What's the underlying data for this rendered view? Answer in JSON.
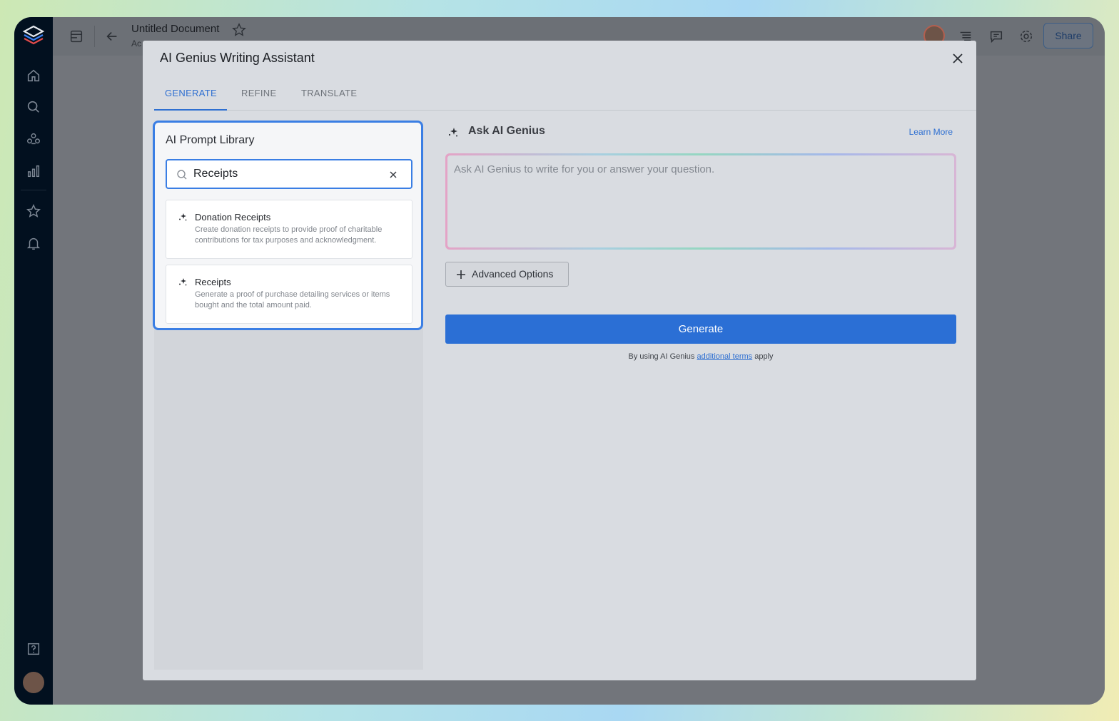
{
  "document": {
    "title": "Untitled Document",
    "subtitle": "Ac",
    "share_label": "Share"
  },
  "modal": {
    "title": "AI Genius Writing Assistant",
    "tabs": [
      {
        "label": "GENERATE",
        "active": true
      },
      {
        "label": "REFINE",
        "active": false
      },
      {
        "label": "TRANSLATE",
        "active": false
      }
    ]
  },
  "library": {
    "title": "AI Prompt Library",
    "search_value": "Receipts",
    "results": [
      {
        "title": "Donation Receipts",
        "description": "Create donation receipts to provide proof of charitable contributions for tax purposes and acknowledgment."
      },
      {
        "title": "Receipts",
        "description": "Generate a proof of purchase detailing services or items bought and the total amount paid."
      }
    ]
  },
  "ask": {
    "title": "Ask AI Genius",
    "learn_more": "Learn More",
    "placeholder": "Ask AI Genius to write for you or answer your question.",
    "advanced_options": "Advanced Options",
    "generate_label": "Generate",
    "terms_prefix": "By using AI Genius",
    "terms_link": "additional terms",
    "terms_suffix": "apply"
  },
  "colors": {
    "accent": "#2b6fd5",
    "sidebar": "#02101f",
    "overlay": "#72757b",
    "modal_bg": "#d9dce1"
  }
}
